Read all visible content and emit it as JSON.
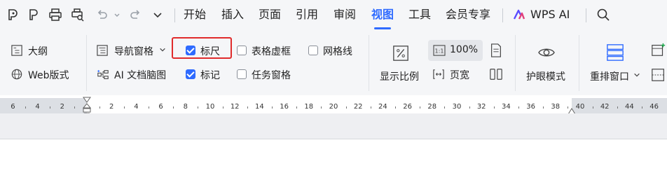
{
  "quick_access": {
    "icons": [
      "home-icon",
      "spellcheck-icon",
      "print-icon",
      "print-preview-icon",
      "undo-icon",
      "redo-icon",
      "more-dropdown-icon"
    ]
  },
  "menu_tabs": [
    {
      "label": "开始",
      "active": false
    },
    {
      "label": "插入",
      "active": false
    },
    {
      "label": "页面",
      "active": false
    },
    {
      "label": "引用",
      "active": false
    },
    {
      "label": "审阅",
      "active": false
    },
    {
      "label": "视图",
      "active": true
    },
    {
      "label": "工具",
      "active": false
    },
    {
      "label": "会员专享",
      "active": false
    }
  ],
  "wps_ai": {
    "label": "WPS AI"
  },
  "ribbon": {
    "outline": "大纲",
    "web_layout": "Web版式",
    "nav_pane": "导航窗格",
    "ai_mindmap": "AI 文档脑图",
    "ruler": {
      "label": "标尺",
      "checked": true
    },
    "markup": {
      "label": "标记",
      "checked": true
    },
    "table_gridlines": {
      "label": "表格虚框",
      "checked": false
    },
    "task_pane": {
      "label": "任务窗格",
      "checked": false
    },
    "gridlines": {
      "label": "网格线",
      "checked": false
    },
    "zoom_ratio": "显示比例",
    "zoom_value": "100%",
    "page_width": "页宽",
    "eye_mode": "护眼模式",
    "arrange_windows": "重排窗口"
  },
  "ruler_ticks": [
    "6",
    "4",
    "2",
    "2",
    "4",
    "6",
    "8",
    "10",
    "12",
    "14",
    "16",
    "18",
    "20",
    "22",
    "24",
    "26",
    "28",
    "30",
    "32",
    "34",
    "36",
    "38",
    "40",
    "42",
    "44",
    "46"
  ],
  "colors": {
    "accent": "#2f6bff",
    "highlight": "#e02b2b",
    "bar_bg": "#f5f6f8"
  }
}
